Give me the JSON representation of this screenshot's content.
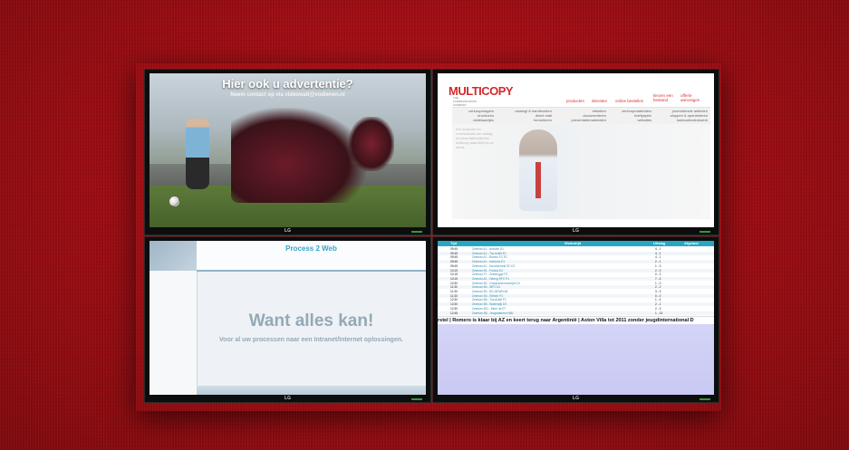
{
  "brand_label": "LG",
  "colors": {
    "wall": "#9f0d13",
    "bezel": "#0d0d0d",
    "accent_multicopy": "#d12a2a",
    "accent_process": "#36a5c9",
    "ticker_area": "#cfcff5"
  },
  "monitor_top_left": {
    "title": "Hier ook u advertentie?",
    "subtitle": "Neem contact op via videowall@vodienen.nl"
  },
  "monitor_top_right": {
    "logo": "MULTICOPY",
    "logo_tagline": "THE COMMUNICATION COMPANY",
    "nav": [
      "producten",
      "diensten",
      "online bestellen",
      "kiezen een bestand",
      "offerte aanvragen"
    ],
    "columns": [
      [
        "verkoopdragers",
        "brochures",
        "visitekaartjes"
      ],
      [
        "catalogi & handboeken",
        "direct mail",
        "formulieren"
      ],
      [
        "etiketten",
        "documenteren",
        "presentatiematerialen"
      ],
      [
        "verkoopmaterialen",
        "briefpapier",
        "websites"
      ],
      [
        "promotionele artikelen",
        "stoppen & openbeleren",
        "kantoorbedrukwerk"
      ]
    ],
    "intro": "Een producten en communicatie van catalog tot presentatiemateriaal, Multicopy staat altijd tot uw dienst."
  },
  "monitor_bottom_left": {
    "header": "Process 2 Web",
    "headline": "Want alles kan!",
    "subline": "Voor al uw processen naar een Intranet/Internet oplossingen."
  },
  "monitor_bottom_right": {
    "columns": [
      "Tijd",
      "Wedstrijd",
      "Uitslag",
      "Afgelast"
    ],
    "rows": [
      {
        "time": "09:45",
        "match": "Zeeman A1 - Ahoude D1",
        "score": "4 - 1"
      },
      {
        "time": "09:45",
        "match": "Zeeman A1 - Tus Actief E1",
        "score": "4 - 1"
      },
      {
        "time": "09:45",
        "match": "Zeeman A1 - Boelos FC E1",
        "score": "4 - 1"
      },
      {
        "time": "09:45",
        "match": "Zeeman A1 - Iverkens E1",
        "score": "2 - 1"
      },
      {
        "time": "09:45",
        "match": "Zeeman A1 - Noordenveld SC E2",
        "score": "1 - 3"
      },
      {
        "time": "10:15",
        "match": "Zeeman B1 - Fortius E2",
        "score": "2 - 0"
      },
      {
        "time": "10:15",
        "match": "Zeeman F1 - Zeebrugge F2",
        "score": "0 - 2"
      },
      {
        "time": "10:15",
        "match": "Zeeman A2 - Olberg RFC F4",
        "score": "7 - 4"
      },
      {
        "time": "10:30",
        "match": "Zeeman B2 - Oranjeboomhoortjes D1",
        "score": "1 - 0"
      },
      {
        "time": "11:30",
        "match": "Zeeman B4 - WFC A1",
        "score": "2 - 2"
      },
      {
        "time": "11:30",
        "match": "Zeeman B4 - BO-NEWN A6",
        "score": "3 - 3"
      },
      {
        "time": "11:30",
        "match": "Zeeman B3 - Rillmer F3",
        "score": "0 - 0"
      },
      {
        "time": "12:30",
        "match": "Zeeman B6 - Tus Actief F1",
        "score": "1 - 4"
      },
      {
        "time": "12:30",
        "match": "Zeeman B6 - Waterwijk D3",
        "score": "2 - 1"
      },
      {
        "time": "12:30",
        "match": "Zeeman B11 - Meer de E7",
        "score": "2 - 3"
      },
      {
        "time": "12:45",
        "match": "Zeeman B5 - Jeugdafkeren NB1",
        "score": "1 - 13"
      }
    ],
    "ticker": "rstel  |  Romero is klaar bij AZ en keert terug naar Argentinië  |  Aston Villa tot 2011 zonder jeugdinternational D"
  }
}
